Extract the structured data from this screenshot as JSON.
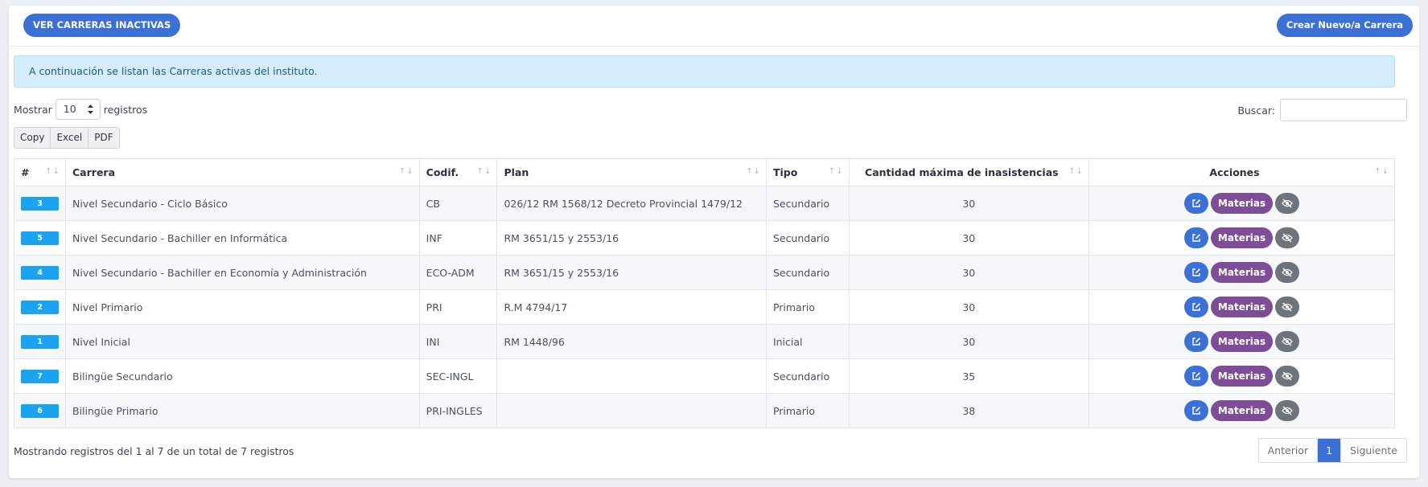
{
  "header": {
    "inactive_button": "VER CARRERAS INACTIVAS",
    "create_button": "Crear Nuevo/a Carrera"
  },
  "alert": {
    "text": "A continuación se listan las Carreras activas del instituto."
  },
  "length": {
    "prefix": "Mostrar",
    "value": "10",
    "suffix": "registros"
  },
  "search": {
    "label": "Buscar:",
    "value": ""
  },
  "export": {
    "copy": "Copy",
    "excel": "Excel",
    "pdf": "PDF"
  },
  "table": {
    "columns": {
      "num": "#",
      "carrera": "Carrera",
      "codif": "Codif.",
      "plan": "Plan",
      "tipo": "Tipo",
      "cantidad": "Cantidad máxima de inasistencias",
      "acciones": "Acciones"
    },
    "materias_label": "Materias",
    "rows": [
      {
        "id": "3",
        "carrera": "Nivel Secundario - Ciclo Básico",
        "codif": "CB",
        "plan": "026/12 RM 1568/12 Decreto Provincial 1479/12",
        "tipo": "Secundario",
        "cantidad": "30"
      },
      {
        "id": "5",
        "carrera": "Nivel Secundario - Bachiller en Informática",
        "codif": "INF",
        "plan": "RM 3651/15 y 2553/16",
        "tipo": "Secundario",
        "cantidad": "30"
      },
      {
        "id": "4",
        "carrera": "Nivel Secundario - Bachiller en Economía y Administración",
        "codif": "ECO-ADM",
        "plan": "RM 3651/15 y 2553/16",
        "tipo": "Secundario",
        "cantidad": "30"
      },
      {
        "id": "2",
        "carrera": "Nivel Primario",
        "codif": "PRI",
        "plan": "R.M 4794/17",
        "tipo": "Primario",
        "cantidad": "30"
      },
      {
        "id": "1",
        "carrera": "Nivel Inicial",
        "codif": "INI",
        "plan": "RM 1448/96",
        "tipo": "Inicial",
        "cantidad": "30"
      },
      {
        "id": "7",
        "carrera": "Bilingüe Secundario",
        "codif": "SEC-INGL",
        "plan": "",
        "tipo": "Secundario",
        "cantidad": "35"
      },
      {
        "id": "6",
        "carrera": "Bilingüe Primario",
        "codif": "PRI-INGLES",
        "plan": "",
        "tipo": "Primario",
        "cantidad": "38"
      }
    ]
  },
  "footer": {
    "info": "Mostrando registros del 1 al 7 de un total de 7 registros",
    "prev": "Anterior",
    "page": "1",
    "next": "Siguiente"
  },
  "colors": {
    "primary": "#3b70d6",
    "badge": "#1aa3f0",
    "materias": "#7d4d98",
    "hide": "#6d747c",
    "alert_bg": "#d4ecfb"
  }
}
